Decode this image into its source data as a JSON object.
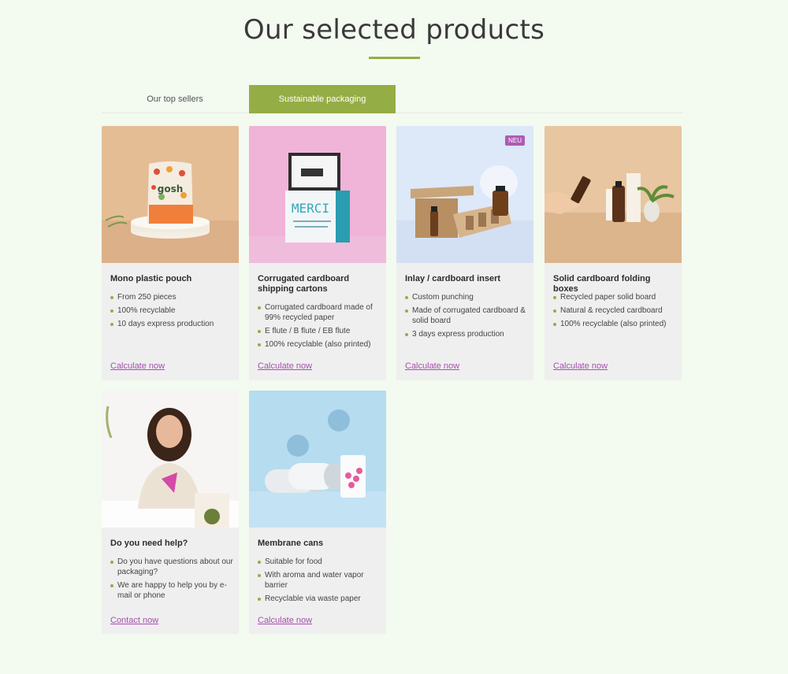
{
  "header": {
    "title": "Our selected products"
  },
  "tabs": [
    {
      "label": "Our top sellers",
      "active": false
    },
    {
      "label": "Sustainable packaging",
      "active": true
    }
  ],
  "colors": {
    "accent": "#95ad45",
    "link": "#a64fae",
    "badge": "#b05ab5",
    "background": "#f3faf0"
  },
  "cards": [
    {
      "title": "Mono plastic pouch",
      "bullets": [
        "From 250 pieces",
        "100% recyclable",
        "10 days express production"
      ],
      "cta": "Calculate now",
      "image_text": "gosh"
    },
    {
      "title": "Corrugated cardboard shipping cartons",
      "bullets": [
        "Corrugated cardboard made of 99% recycled paper",
        "E flute / B flute / EB flute",
        "100% recyclable (also printed)"
      ],
      "cta": "Calculate now",
      "image_text": "MERCI"
    },
    {
      "title": "Inlay / cardboard insert",
      "bullets": [
        "Custom punching",
        "Made of corrugated cardboard & solid board",
        "3 days express production"
      ],
      "cta": "Calculate now",
      "badge": "NEU"
    },
    {
      "title": "Solid cardboard folding boxes",
      "bullets": [
        "Recycled paper solid board",
        "Natural & recycled cardboard",
        "100% recyclable (also printed)"
      ],
      "cta": "Calculate now"
    },
    {
      "title": "Do you need help?",
      "bullets": [
        "Do you have questions about our packaging?",
        "We are happy to help you by e-mail or phone"
      ],
      "cta": "Contact now"
    },
    {
      "title": "Membrane cans",
      "bullets": [
        "Suitable for food",
        "With aroma and water vapor barrier",
        "Recyclable via waste paper"
      ],
      "cta": "Calculate now"
    }
  ]
}
